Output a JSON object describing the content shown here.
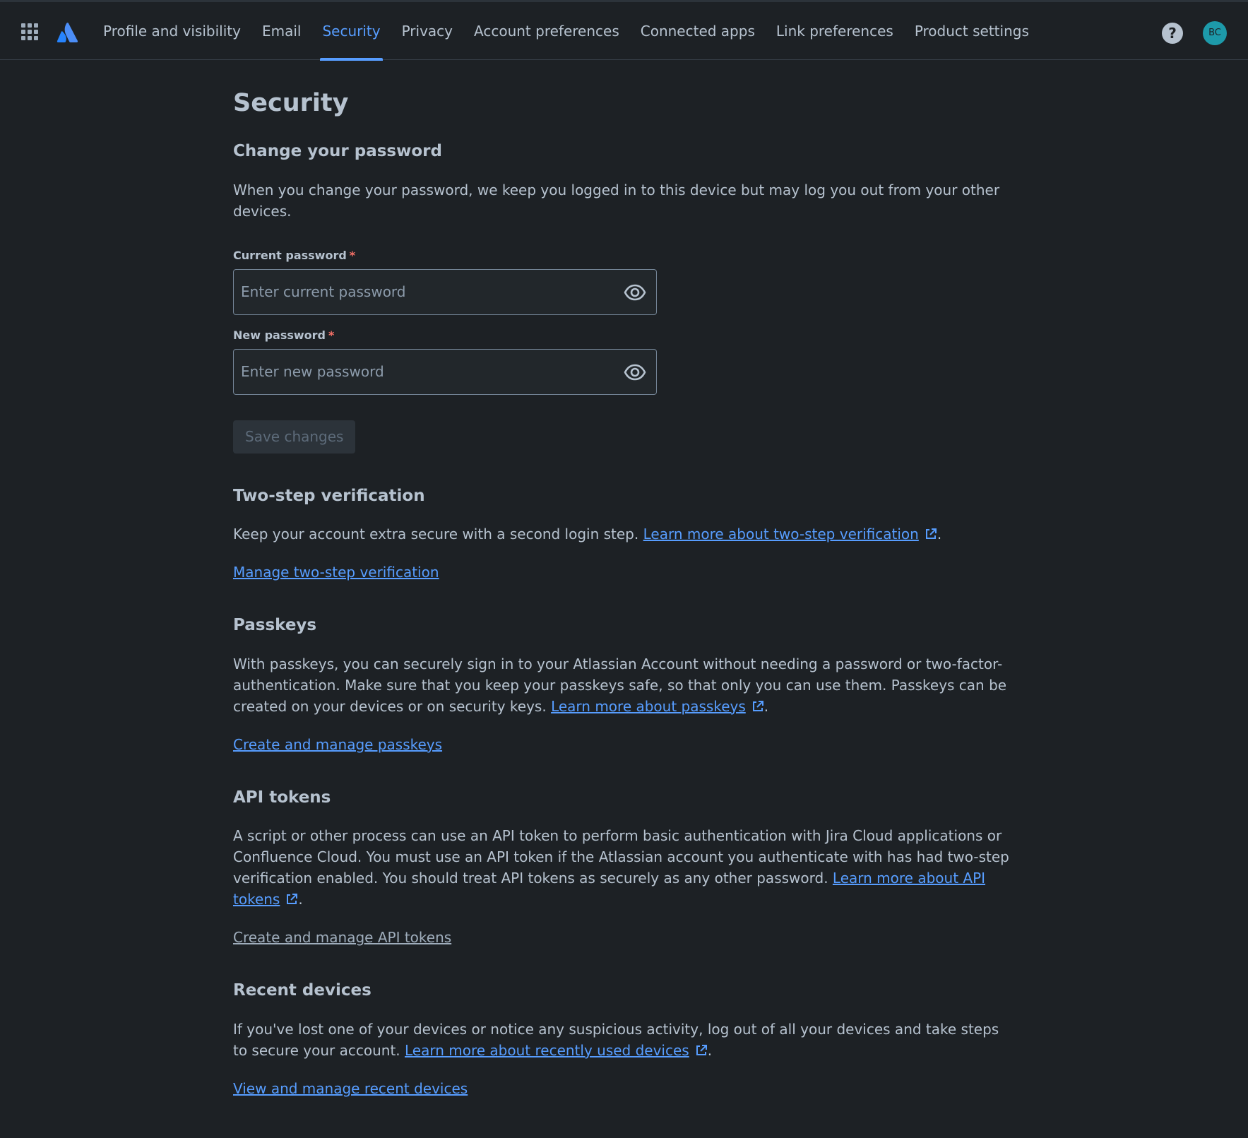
{
  "header": {
    "nav": [
      {
        "label": "Profile and visibility"
      },
      {
        "label": "Email"
      },
      {
        "label": "Security"
      },
      {
        "label": "Privacy"
      },
      {
        "label": "Account preferences"
      },
      {
        "label": "Connected apps"
      },
      {
        "label": "Link preferences"
      },
      {
        "label": "Product settings"
      }
    ],
    "help_glyph": "?",
    "avatar_initials": "BC",
    "accent_color": "#579dff"
  },
  "page": {
    "title": "Security"
  },
  "password": {
    "heading": "Change your password",
    "description": "When you change your password, we keep you logged in to this device but may log you out from your other devices.",
    "current_label": "Current password",
    "current_placeholder": "Enter current password",
    "new_label": "New password",
    "new_placeholder": "Enter new password",
    "required_mark": "*",
    "save_label": "Save changes"
  },
  "two_step": {
    "heading": "Two-step verification",
    "description": "Keep your account extra secure with a second login step.",
    "learn_more": "Learn more about two-step verification",
    "manage_link": "Manage two-step verification"
  },
  "passkeys": {
    "heading": "Passkeys",
    "description": "With passkeys, you can securely sign in to your Atlassian Account without needing a password or two-factor-authentication. Make sure that you keep your passkeys safe, so that only you can use them. Passkeys can be created on your devices or on security keys.",
    "learn_more": "Learn more about passkeys",
    "manage_link": "Create and manage passkeys"
  },
  "api_tokens": {
    "heading": "API tokens",
    "description": "A script or other process can use an API token to perform basic authentication with Jira Cloud applications or Confluence Cloud. You must use an API token if the Atlassian account you authenticate with has had two-step verification enabled. You should treat API tokens as securely as any other password.",
    "learn_more": "Learn more about API tokens",
    "manage_link": "Create and manage API tokens"
  },
  "recent_devices": {
    "heading": "Recent devices",
    "description": "If you've lost one of your devices or notice any suspicious activity, log out of all your devices and take steps to secure your account.",
    "learn_more": "Learn more about recently used devices",
    "manage_link": "View and manage recent devices"
  },
  "punctuation": {
    "period": "."
  }
}
